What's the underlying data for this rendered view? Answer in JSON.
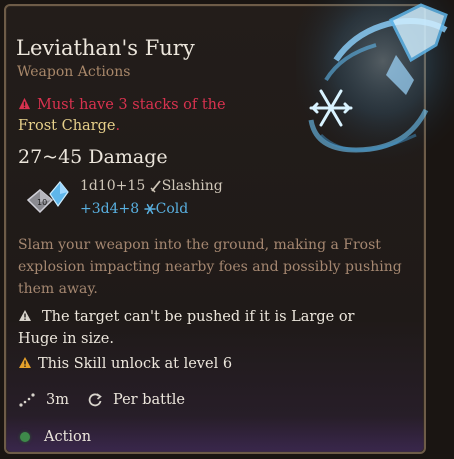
{
  "spell": {
    "title": "Leviathan's Fury",
    "category": "Weapon Actions",
    "requirement_prefix": "Must have 3 stacks of the ",
    "requirement_highlight_1": "Frost",
    "requirement_highlight_2": "Charge",
    "requirement_suffix": ".",
    "damage": "27~45 Damage",
    "damage_primary_roll": "1d10+15",
    "damage_primary_type": "Slashing",
    "damage_secondary_roll": "+3d4+8",
    "damage_secondary_type": "Cold",
    "description": "Slam your weapon into the ground, making a Frost explosion impacting nearby foes and possibly pushing them away.",
    "note_push": "The target can't be pushed if it is Large or Huge in size.",
    "note_unlock": "This Skill unlock at level 6",
    "range": "3m",
    "recharge": "Per battle",
    "cost": "Action"
  },
  "colors": {
    "requirement": "#d9324f",
    "highlight": "#e6cf8a",
    "cold": "#59b0e0",
    "description": "#a58770",
    "action_dot": "#3e8a4a"
  },
  "icons": [
    "warning-icon",
    "dice-icon",
    "dagger-icon",
    "snowflake-icon",
    "info-triangle-icon",
    "caution-icon",
    "range-icon",
    "recharge-icon",
    "spell-art-icon"
  ]
}
